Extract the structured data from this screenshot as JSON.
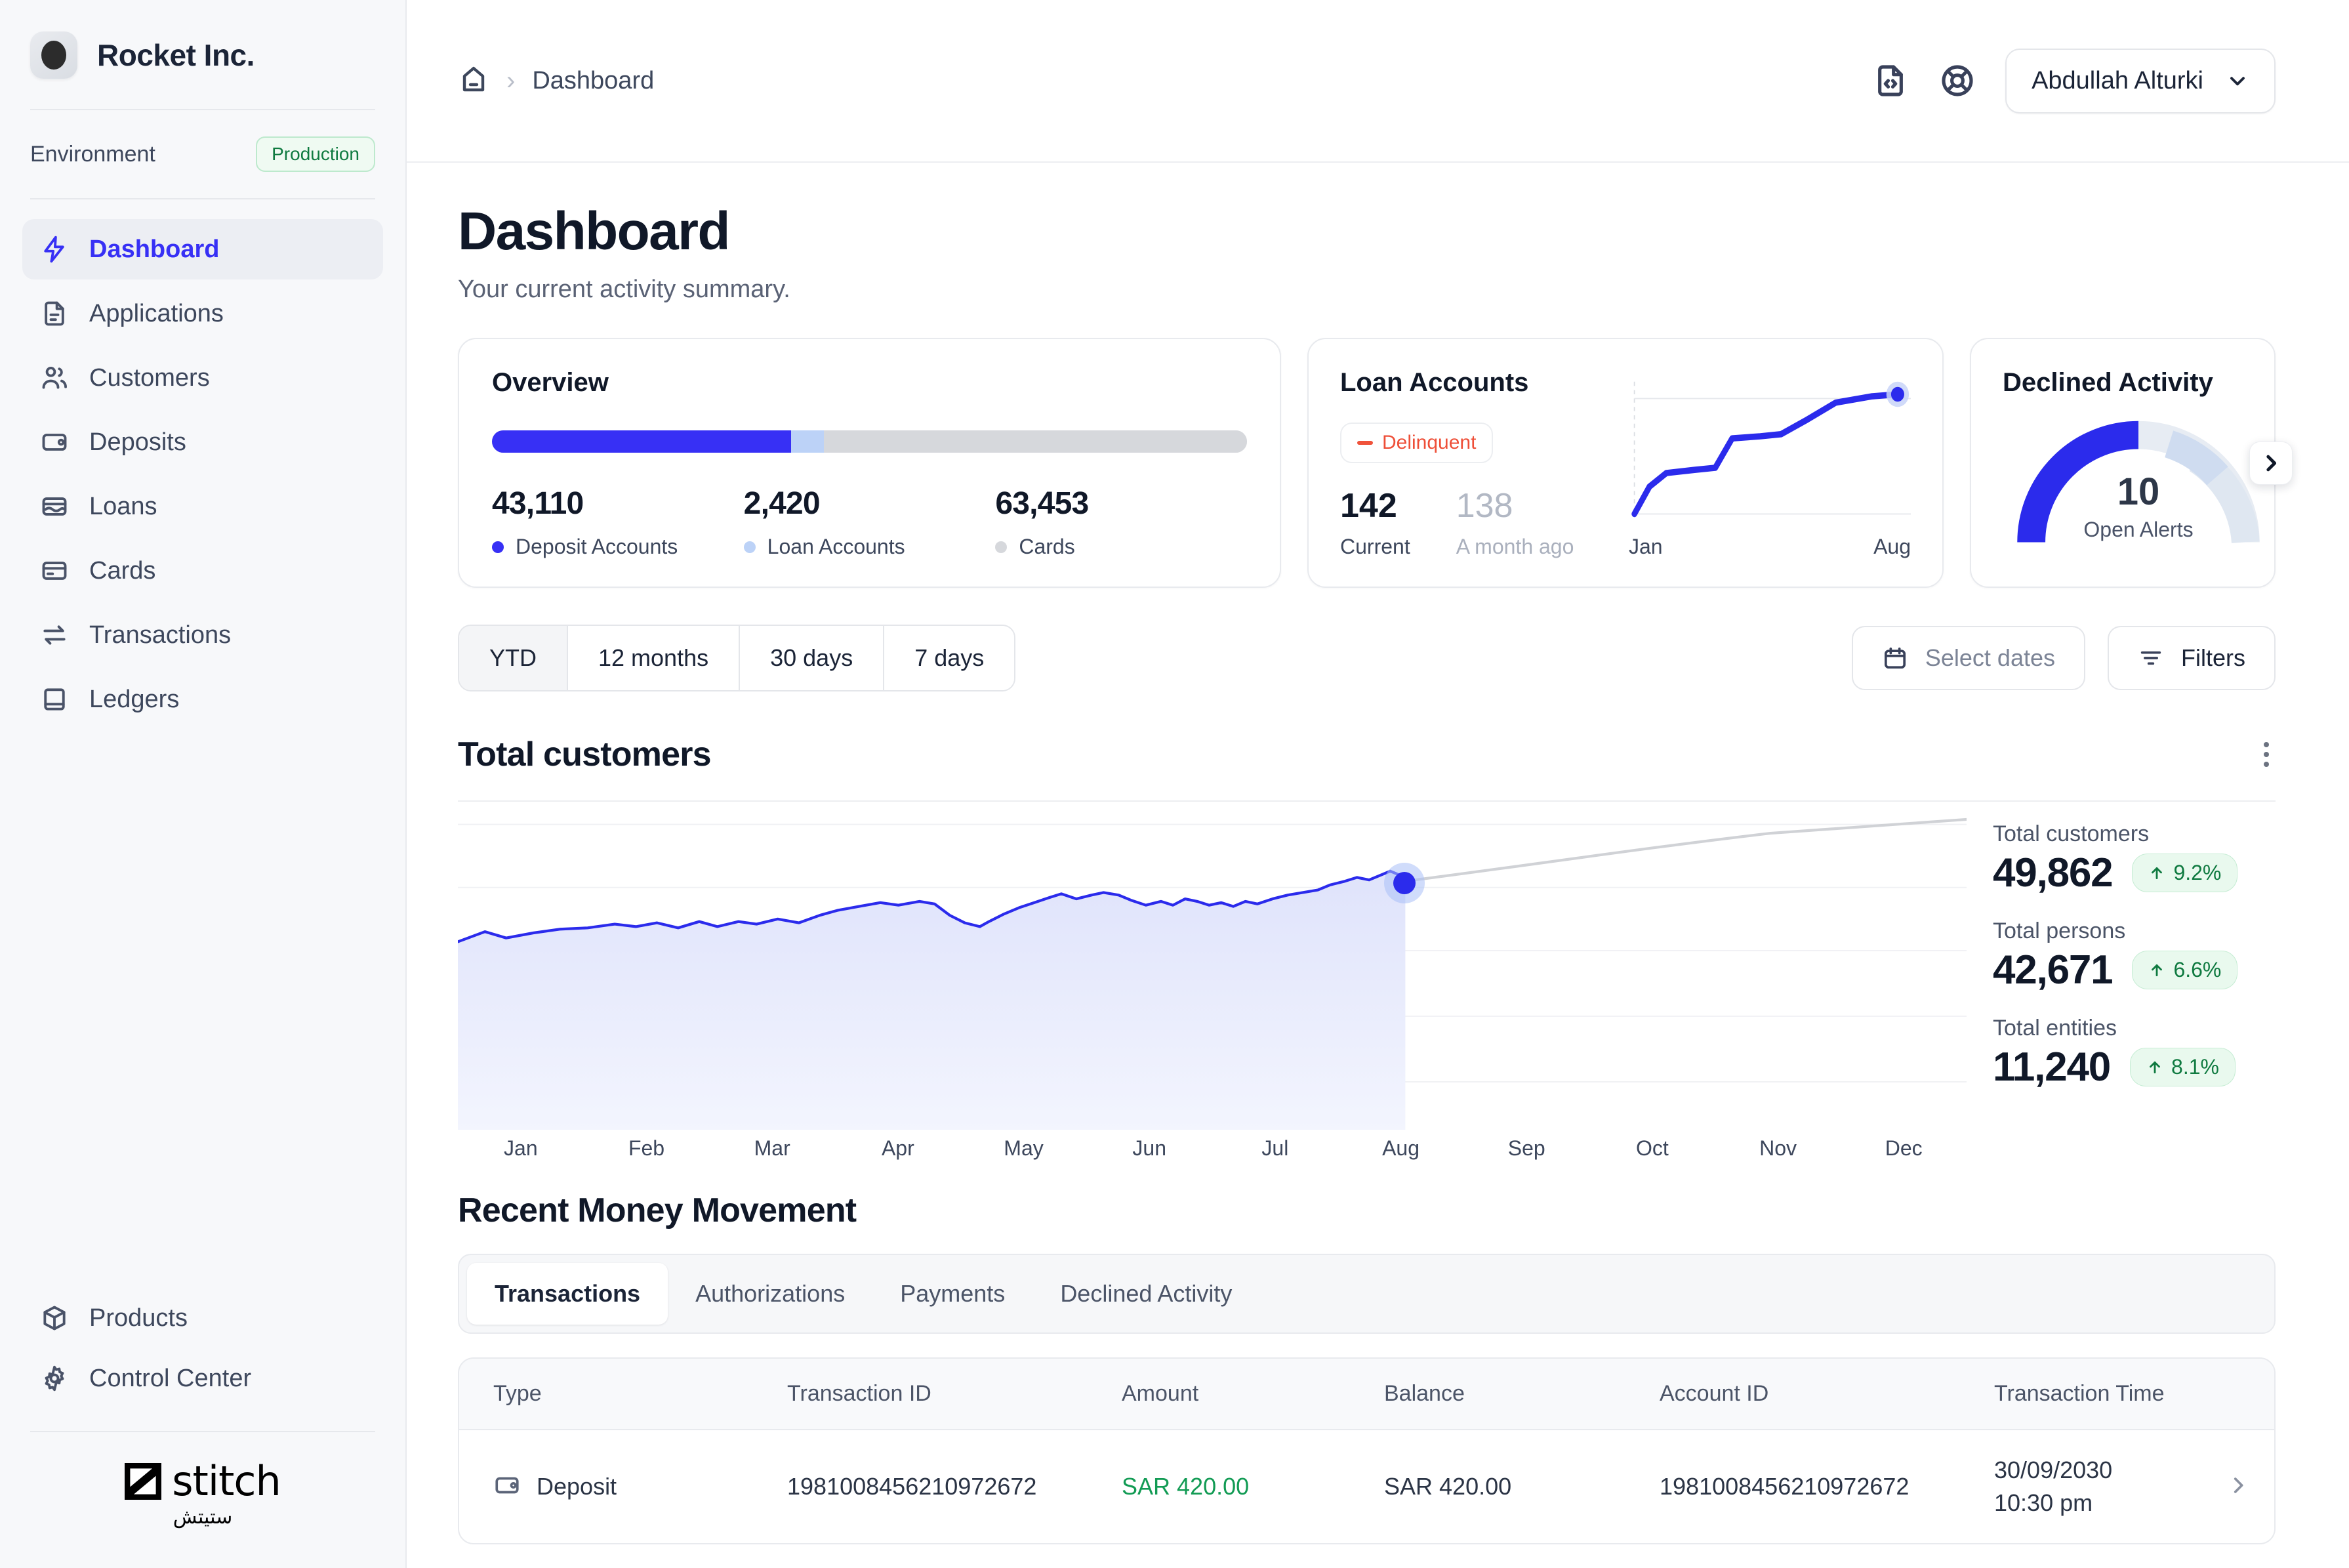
{
  "sidebar": {
    "brand_name": "Rocket Inc.",
    "environment_label": "Environment",
    "environment_value": "Production",
    "items": [
      {
        "label": "Dashboard",
        "icon": "bolt-icon",
        "active": true
      },
      {
        "label": "Applications",
        "icon": "document-icon",
        "active": false
      },
      {
        "label": "Customers",
        "icon": "users-icon",
        "active": false
      },
      {
        "label": "Deposits",
        "icon": "wallet-icon",
        "active": false
      },
      {
        "label": "Loans",
        "icon": "card-wave-icon",
        "active": false
      },
      {
        "label": "Cards",
        "icon": "credit-card-icon",
        "active": false
      },
      {
        "label": "Transactions",
        "icon": "transfer-icon",
        "active": false
      },
      {
        "label": "Ledgers",
        "icon": "book-icon",
        "active": false
      }
    ],
    "bottom_items": [
      {
        "label": "Products",
        "icon": "box-icon"
      },
      {
        "label": "Control Center",
        "icon": "gear-icon"
      }
    ],
    "footer_logo": "stitch",
    "footer_logo_arabic": "ستيتش"
  },
  "topbar": {
    "breadcrumb_home": "home-icon",
    "breadcrumb_separator": "›",
    "breadcrumb_current": "Dashboard",
    "docs_icon": "code-file-icon",
    "support_icon": "lifebuoy-icon",
    "user_name": "Abdullah Alturki"
  },
  "page": {
    "title": "Dashboard",
    "subtitle": "Your current activity summary."
  },
  "overview": {
    "title": "Overview",
    "segments": [
      {
        "label": "Deposit Accounts",
        "value": "43,110",
        "color": "#3730f5",
        "percent": 39.6
      },
      {
        "label": "Loan Accounts",
        "value": "2,420",
        "color": "#bcd2f7",
        "percent": 4.4
      },
      {
        "label": "Cards",
        "value": "63,453",
        "color": "#d6d8dc",
        "percent": 56.0
      }
    ]
  },
  "loan_accounts": {
    "title": "Loan Accounts",
    "badge": "Delinquent",
    "badge_color": "#ee4f38",
    "current_value": "142",
    "current_label": "Current",
    "previous_value": "138",
    "previous_label": "A month ago",
    "axis_start": "Jan",
    "axis_end": "Aug"
  },
  "declined_activity": {
    "title": "Declined Activity",
    "value": "10",
    "label": "Open Alerts",
    "next_icon": "chevron-right-icon"
  },
  "toolbar": {
    "ranges": [
      {
        "label": "YTD",
        "active": true
      },
      {
        "label": "12 months",
        "active": false
      },
      {
        "label": "30 days",
        "active": false
      },
      {
        "label": "7 days",
        "active": false
      }
    ],
    "select_dates": "Select dates",
    "filters": "Filters"
  },
  "chart_section": {
    "title": "Total customers",
    "menu_icon": "kebab-menu-icon"
  },
  "stats": [
    {
      "label": "Total customers",
      "value": "49,862",
      "delta": "9.2%",
      "direction": "up"
    },
    {
      "label": "Total persons",
      "value": "42,671",
      "delta": "6.6%",
      "direction": "up"
    },
    {
      "label": "Total entities",
      "value": "11,240",
      "delta": "8.1%",
      "direction": "up"
    }
  ],
  "money_movement": {
    "title": "Recent Money Movement",
    "tabs": [
      {
        "label": "Transactions",
        "active": true
      },
      {
        "label": "Authorizations",
        "active": false
      },
      {
        "label": "Payments",
        "active": false
      },
      {
        "label": "Declined Activity",
        "active": false
      }
    ],
    "columns": [
      "Type",
      "Transaction ID",
      "Amount",
      "Balance",
      "Account ID",
      "Transaction Time"
    ],
    "rows": [
      {
        "type": "Deposit",
        "type_icon": "wallet-icon",
        "transaction_id": "1981008456210972672",
        "amount": "SAR 420.00",
        "balance": "SAR 420.00",
        "account_id": "1981008456210972672",
        "time_date": "30/09/2030",
        "time_clock": "10:30 pm"
      }
    ]
  },
  "chart_data": {
    "type": "area",
    "title": "Total customers",
    "xlabel": "",
    "ylabel": "",
    "categories": [
      "Jan",
      "Feb",
      "Mar",
      "Apr",
      "May",
      "Jun",
      "Jul",
      "Aug",
      "Sep",
      "Oct",
      "Nov",
      "Dec"
    ],
    "grid": true,
    "legend": "none",
    "series": [
      {
        "name": "Actual customers",
        "color": "#2b2bec",
        "type": "area",
        "x": [
          "Jan",
          "Jan",
          "Feb",
          "Feb",
          "Mar",
          "Mar",
          "Apr",
          "Apr",
          "May",
          "May",
          "Jun",
          "Jun",
          "Jul",
          "Jul",
          "Aug"
        ],
        "values": [
          30000,
          32000,
          32500,
          34000,
          35500,
          36000,
          39000,
          40500,
          37500,
          41500,
          43500,
          42000,
          43000,
          45500,
          49862
        ]
      },
      {
        "name": "Projection",
        "color": "#d0d2d6",
        "type": "line",
        "dashed": false,
        "x": [
          "Aug",
          "Sep",
          "Oct",
          "Nov",
          "Dec"
        ],
        "values": [
          49862,
          52500,
          55500,
          58500,
          62000
        ]
      }
    ],
    "marker": {
      "x": "Aug",
      "value": 49862,
      "color": "#2b2bec"
    },
    "ylim": [
      20000,
      66000
    ]
  },
  "loan_chart_data": {
    "type": "line",
    "color": "#2b2bec",
    "categories": [
      "Jan",
      "Feb",
      "Mar",
      "Apr",
      "May",
      "Jun",
      "Jul",
      "Aug"
    ],
    "values": [
      110,
      124,
      129,
      130,
      136,
      136,
      140,
      142
    ],
    "marker_last": true
  },
  "gauge_data": {
    "type": "gauge",
    "value": 10,
    "label": "Open Alerts",
    "segments": [
      {
        "color": "#2b2bec",
        "fraction": 0.5
      },
      {
        "color": "#bdd2f0",
        "fraction": 0.16
      },
      {
        "color": "#d3dff2",
        "fraction": 0.16
      },
      {
        "color": "#e7ecf3",
        "fraction": 0.18
      }
    ]
  }
}
